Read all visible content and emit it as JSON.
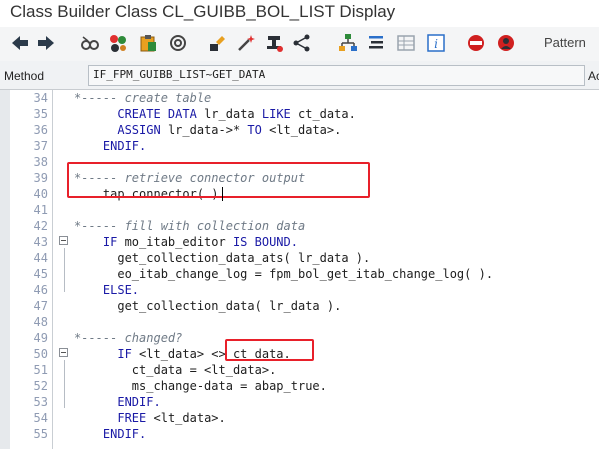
{
  "window": {
    "title": "Class Builder Class CL_GUIBB_BOL_LIST Display"
  },
  "toolbar": {
    "pattern_label": "Pattern",
    "icons": [
      "back-arrow-icon",
      "forward-arrow-icon",
      "glasses-icon",
      "objects-icon",
      "clipboard-icon",
      "wheel-icon",
      "hierarchy-up-icon",
      "magic-wand-icon",
      "stamp-icon",
      "graph-icon",
      "tree-icon",
      "list-icon",
      "table-icon",
      "info-icon",
      "stop-bug-icon",
      "user-bug-icon"
    ]
  },
  "method": {
    "label": "Method",
    "value": "IF_FPM_GUIBB_LIST~GET_DATA",
    "trailing": "Ac"
  },
  "editor": {
    "lines": [
      {
        "n": "34",
        "segs": [
          [
            "cm",
            "*----- create table"
          ]
        ]
      },
      {
        "n": "35",
        "segs": [
          [
            "sp",
            "      "
          ],
          [
            "kw",
            "CREATE DATA"
          ],
          [
            "tx",
            " lr_data "
          ],
          [
            "kw",
            "LIKE"
          ],
          [
            "tx",
            " ct_data."
          ]
        ]
      },
      {
        "n": "36",
        "segs": [
          [
            "sp",
            "      "
          ],
          [
            "kw",
            "ASSIGN"
          ],
          [
            "tx",
            " lr_data->* "
          ],
          [
            "kw",
            "TO"
          ],
          [
            "tx",
            " <lt_data>."
          ]
        ]
      },
      {
        "n": "37",
        "segs": [
          [
            "sp",
            "    "
          ],
          [
            "kw",
            "ENDIF."
          ]
        ]
      },
      {
        "n": "38",
        "segs": []
      },
      {
        "n": "39",
        "segs": [
          [
            "cm",
            "*----- retrieve connector output"
          ]
        ]
      },
      {
        "n": "40",
        "segs": [
          [
            "sp",
            "    "
          ],
          [
            "tx",
            "tap connector( )."
          ]
        ]
      },
      {
        "n": "41",
        "segs": []
      },
      {
        "n": "42",
        "segs": [
          [
            "cm",
            "*----- fill with collection data"
          ]
        ]
      },
      {
        "n": "43",
        "segs": [
          [
            "sp",
            "    "
          ],
          [
            "kw",
            "IF"
          ],
          [
            "tx",
            " mo_itab_editor "
          ],
          [
            "kw",
            "IS BOUND."
          ]
        ]
      },
      {
        "n": "44",
        "segs": [
          [
            "sp",
            "      "
          ],
          [
            "tx",
            "get_collection_data_ats( lr_data )."
          ]
        ]
      },
      {
        "n": "45",
        "segs": [
          [
            "sp",
            "      "
          ],
          [
            "tx",
            "eo_itab_change_log = fpm_bol_get_itab_change_log( )."
          ]
        ]
      },
      {
        "n": "46",
        "segs": [
          [
            "sp",
            "    "
          ],
          [
            "kw",
            "ELSE."
          ]
        ]
      },
      {
        "n": "47",
        "segs": [
          [
            "sp",
            "      "
          ],
          [
            "tx",
            "get_collection_data( lr_data )."
          ]
        ]
      },
      {
        "n": "48",
        "segs": []
      },
      {
        "n": "49",
        "segs": [
          [
            "cm",
            "*----- changed?"
          ]
        ]
      },
      {
        "n": "50",
        "segs": [
          [
            "sp",
            "      "
          ],
          [
            "kw",
            "IF"
          ],
          [
            "tx",
            " <lt_data> <> ct_data."
          ]
        ]
      },
      {
        "n": "51",
        "segs": [
          [
            "sp",
            "        "
          ],
          [
            "tx",
            "ct_data = <lt_data>."
          ]
        ]
      },
      {
        "n": "52",
        "segs": [
          [
            "sp",
            "        "
          ],
          [
            "tx",
            "ms_change-data = abap_true."
          ]
        ]
      },
      {
        "n": "53",
        "segs": [
          [
            "sp",
            "      "
          ],
          [
            "kw",
            "ENDIF."
          ]
        ]
      },
      {
        "n": "54",
        "segs": [
          [
            "sp",
            "      "
          ],
          [
            "kw",
            "FREE"
          ],
          [
            "tx",
            " <lt_data>."
          ]
        ]
      },
      {
        "n": "55",
        "segs": [
          [
            "sp",
            "    "
          ],
          [
            "kw",
            "ENDIF."
          ]
        ]
      }
    ]
  }
}
